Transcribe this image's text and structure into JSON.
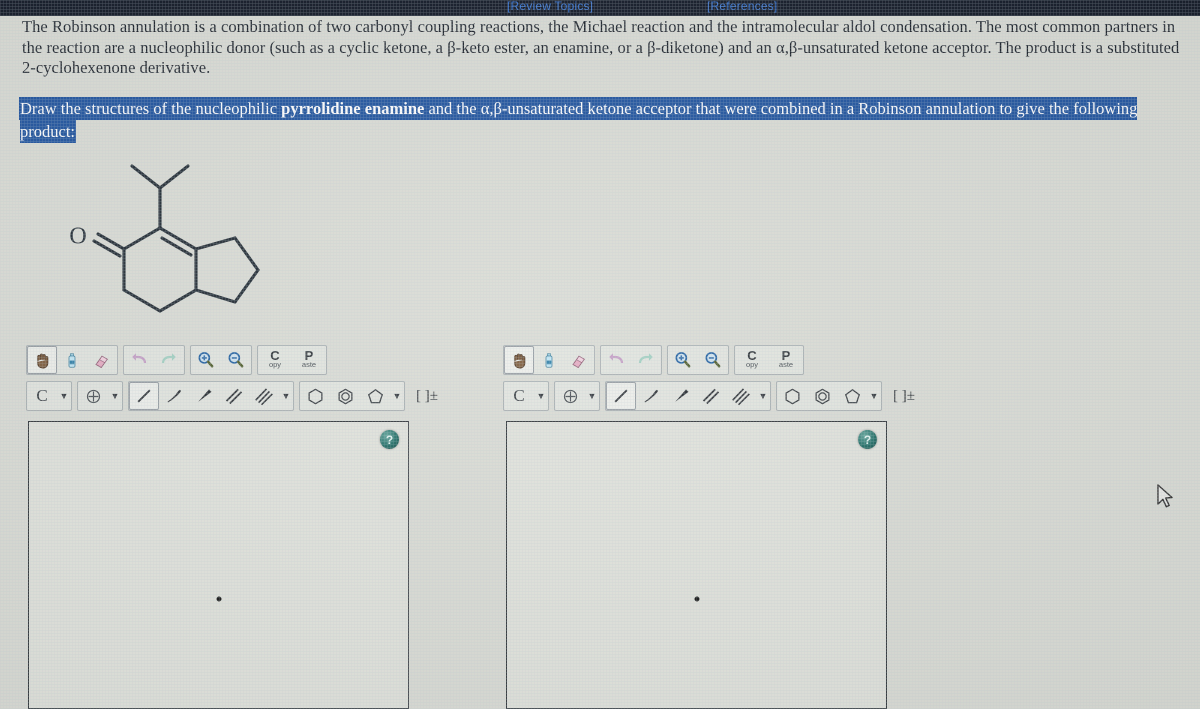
{
  "header": {
    "review_topics": "[Review Topics]",
    "references": "[References]"
  },
  "intro": {
    "paragraph": "The Robinson annulation is a combination of two carbonyl coupling reactions, the Michael reaction and the intramolecular aldol condensation. The most common partners in the reaction are a nucleophilic donor (such as a cyclic ketone, a β-keto ester, an enamine, or a β-diketone) and an α,β-unsaturated ketone acceptor. The product is a substituted 2-cyclohexenone derivative."
  },
  "prompt": {
    "part1": "Draw the structures of the nucleophilic ",
    "bold1": "pyrrolidine enamine",
    "part2": " and the ",
    "alpha_beta": "α,β-unsaturated ketone",
    "part3": " acceptor that were combined in a Robinson annulation to give the following product:"
  },
  "structure": {
    "name": "robinson-annulation-product",
    "oxygen_label": "O",
    "description": "bicyclic ketone: cyclohexenone fused to cyclopentane with isopropyl substituent"
  },
  "toolbar": {
    "row1": [
      {
        "name": "lasso-hand-tool",
        "icon": "hand-icon",
        "label": ""
      },
      {
        "name": "eraser-tool",
        "icon": "spray-bottle-icon",
        "label": ""
      },
      {
        "name": "eraser-pink-tool",
        "icon": "eraser-icon",
        "label": ""
      },
      {
        "name": "undo-button",
        "icon": "undo-arrow-icon",
        "label": ""
      },
      {
        "name": "redo-button",
        "icon": "redo-arrow-icon",
        "label": ""
      },
      {
        "name": "zoom-in-button",
        "icon": "magnifier-plus-icon",
        "label": ""
      },
      {
        "name": "zoom-out-button",
        "icon": "magnifier-minus-icon",
        "label": ""
      },
      {
        "name": "copy-button",
        "icon": "copy-icon",
        "label": "C",
        "sub": "opy"
      },
      {
        "name": "paste-button",
        "icon": "paste-icon",
        "label": "P",
        "sub": "aste"
      }
    ],
    "row2": [
      {
        "name": "atom-carbon-tool",
        "icon": "atom-c-icon",
        "label": "C"
      },
      {
        "name": "atom-dropdown",
        "icon": "chevron-down-icon",
        "label": ""
      },
      {
        "name": "charge-tool",
        "icon": "plus-circle-icon",
        "label": ""
      },
      {
        "name": "charge-dropdown",
        "icon": "chevron-down-icon",
        "label": ""
      },
      {
        "name": "single-bond-tool",
        "icon": "single-bond-icon",
        "label": ""
      },
      {
        "name": "hashed-wedge-bond-tool",
        "icon": "hashed-wedge-icon",
        "label": ""
      },
      {
        "name": "solid-wedge-bond-tool",
        "icon": "solid-wedge-icon",
        "label": ""
      },
      {
        "name": "double-bond-tool",
        "icon": "double-bond-icon",
        "label": ""
      },
      {
        "name": "triple-bond-tool",
        "icon": "triple-bond-icon",
        "label": ""
      },
      {
        "name": "bond-dropdown",
        "icon": "chevron-down-icon",
        "label": ""
      },
      {
        "name": "cyclohexane-ring-tool",
        "icon": "hexagon-icon",
        "label": ""
      },
      {
        "name": "benzene-ring-tool",
        "icon": "benzene-icon",
        "label": ""
      },
      {
        "name": "cyclopentane-ring-tool",
        "icon": "pentagon-icon",
        "label": ""
      },
      {
        "name": "ring-dropdown",
        "icon": "chevron-down-icon",
        "label": ""
      },
      {
        "name": "bracket-charge-tool",
        "icon": "bracket-charge-icon",
        "label": "[ ]±"
      }
    ]
  },
  "canvases": [
    {
      "name": "enamine-drawing-canvas",
      "help_label": "?"
    },
    {
      "name": "ketone-drawing-canvas",
      "help_label": "?"
    }
  ],
  "colors": {
    "highlight": "#1a4f9c",
    "link": "#2f6fd0",
    "header_bg": "#0b1220",
    "help_button": "#1d6b63",
    "page_bg": "#d9dbd4"
  }
}
